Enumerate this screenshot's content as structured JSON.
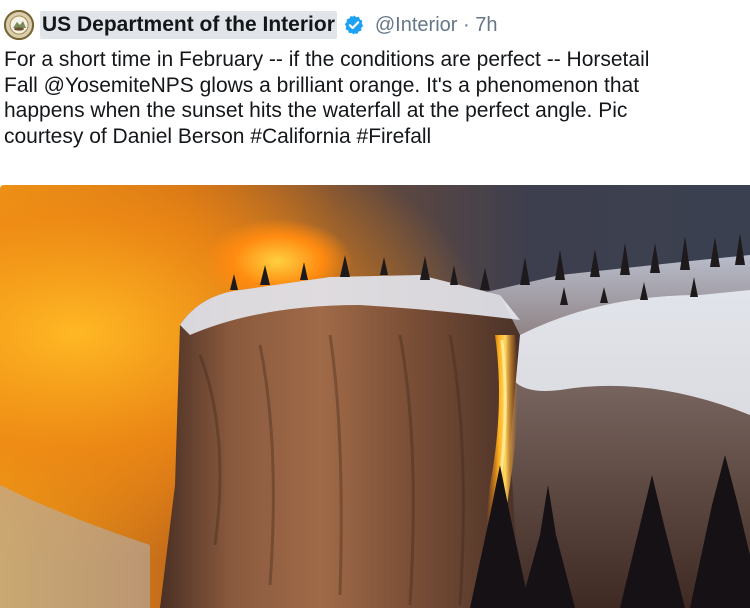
{
  "tweet": {
    "author_name": "US Department of the Interior",
    "handle": "@Interior",
    "separator": "·",
    "time": "7h",
    "verified": true,
    "text": "For a short time in February -- if the conditions are perfect -- Horsetail\nFall @YosemiteNPS glows a brilliant orange. It's a phenomenon that\nhappens when the sunset hits the waterfall at the perfect angle. Pic\ncourtesy of Daniel Berson #California  #Firefall"
  },
  "icons": {
    "avatar": "doi-seal-avatar",
    "verified": "verified-badge-icon"
  },
  "colors": {
    "verified_blue": "#1da1f2",
    "text_primary": "#14171a",
    "text_secondary": "#657786",
    "name_highlight": "#e1e4e8"
  }
}
